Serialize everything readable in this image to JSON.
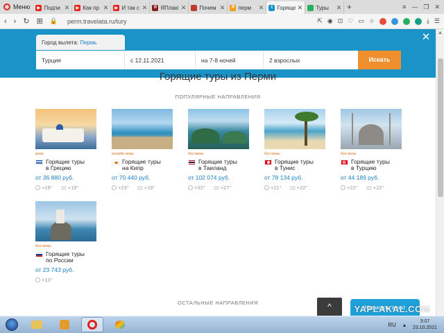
{
  "browser": {
    "menu_label": "Меню",
    "tabs": [
      {
        "label": "Подпи",
        "color": "#e62117",
        "active": false
      },
      {
        "label": "Как пр",
        "color": "#e62117",
        "active": false
      },
      {
        "label": "И так с",
        "color": "#e62117",
        "active": false
      },
      {
        "label": "ЯПлакі",
        "color": "#8a1c1c",
        "active": false
      },
      {
        "label": "Почем",
        "color": "#c0392b",
        "active": false
      },
      {
        "label": "перм",
        "color": "#f39c12",
        "active": false
      },
      {
        "label": "Горяще",
        "color": "#1a93c9",
        "active": true
      },
      {
        "label": "Туры",
        "color": "#27ae60",
        "active": false
      }
    ],
    "url": "perm.travelata.ru/tury"
  },
  "search": {
    "city_label": "Город вылета:",
    "city_value": "Пермь",
    "country": "Турция",
    "date": "с 12.11.2021",
    "nights": "на 7-8 ночей",
    "people": "2 взрослых",
    "button": "Искать",
    "close": "✕"
  },
  "page": {
    "title": "Горящие туры из Перми",
    "popular_label": "ПОПУЛЯРНЫЕ НАПРАВЛЕНИЯ",
    "others_label": "ОСТАЛЬНЫЕ НАПРАВЛЕНИЯ",
    "chat_button": "Написать в чат",
    "up_icon": "^"
  },
  "cards": [
    {
      "visa": "виза",
      "name1": "Горящие туры",
      "name2": "в Грецию",
      "price": "от 36 880 руб.",
      "air": "+18°",
      "water": "+19°"
    },
    {
      "visa": "онлайн виза",
      "name1": "Горящие туры",
      "name2": "на Кипр",
      "price": "от 70 440 руб.",
      "air": "+23°",
      "water": "+19°"
    },
    {
      "visa": "без визы",
      "name1": "Горящие туры",
      "name2": "в Таиланд",
      "price": "от 102 074 руб.",
      "air": "+32°",
      "water": "+27°"
    },
    {
      "visa": "без визы",
      "name1": "Горящие туры",
      "name2": "в Тунис",
      "price": "от 78 134 руб.",
      "air": "+21°",
      "water": "+22°"
    },
    {
      "visa": "без визы",
      "name1": "Горящие туры",
      "name2": "в Турцию",
      "price": "от 44 189 руб.",
      "air": "+22°",
      "water": "+22°"
    },
    {
      "visa": "без визы",
      "name1": "Горящие туры",
      "name2": "по России",
      "price": "от 23 743 руб.",
      "air": "+13°",
      "water": ""
    }
  ],
  "taskbar": {
    "lang": "RU",
    "time": "3:07",
    "date": "23.10.2021"
  },
  "watermark": "YAPLAKAL.COM"
}
